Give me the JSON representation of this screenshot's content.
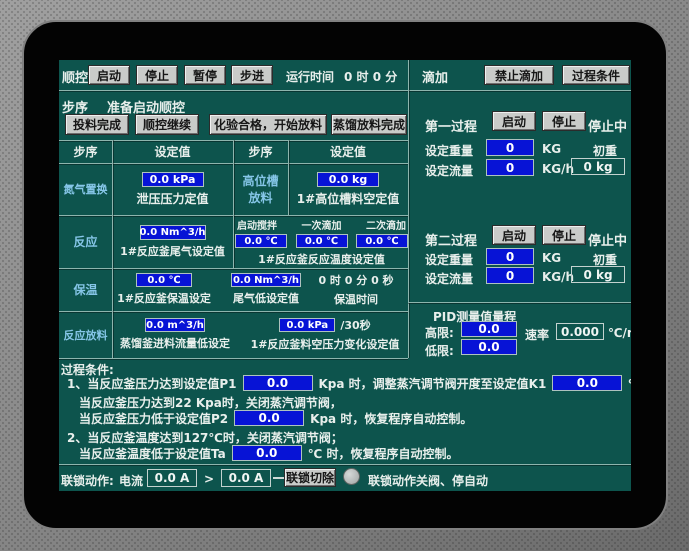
{
  "colors": {
    "screen_bg": "#0d544d",
    "input_blue": "#0713d6",
    "row_label_blue": "#86c6e8",
    "button_gray": "#c9cbc9",
    "divider": "#8db5ae"
  },
  "top_bar": {
    "seq_label": "顺控",
    "start": "启动",
    "stop": "停止",
    "pause": "暂停",
    "step": "步进",
    "runtime_label": "运行时间",
    "runtime_value": "0 时 0 分",
    "drip_label": "滴加",
    "forbid_drip": "禁止滴加",
    "process_cond": "过程条件"
  },
  "step_line": {
    "label": "步序",
    "value": "准备启动顺控"
  },
  "action_buttons": {
    "feed_done": "投料完成",
    "seq_continue": "顺控继续",
    "test_pass": "化验合格，开始放料",
    "distill_done": "蒸馏放料完成"
  },
  "table": {
    "header": [
      "步序",
      "设定值",
      "步序",
      "设定值"
    ],
    "row1": {
      "label": "氮气置换",
      "value1": "0.0 kPa",
      "caption1": "泄压压力定值",
      "label2": "高位槽放料",
      "value2": "0.0 kg",
      "caption2": "1#高位槽料空定值"
    },
    "row2": {
      "label": "反应",
      "value1": "0.0 Nm^3/h",
      "caption1": "1#反应釜尾气设定值",
      "sublabels": [
        "启动搅拌",
        "一次滴加",
        "二次滴加"
      ],
      "values": [
        "0.0 ℃",
        "0.0 ℃",
        "0.0 ℃"
      ],
      "caption2": "1#反应釜反应温度设定值"
    },
    "row3": {
      "label": "保温",
      "value1": "0.0 ℃",
      "caption1": "1#反应釜保温设定",
      "value2": "0.0 Nm^3/h",
      "caption2": "尾气低设定值",
      "time_value": "0 时 0 分 0 秒",
      "time_caption": "保温时间"
    },
    "row4": {
      "label": "反应放料",
      "value1": "0.0 m^3/h",
      "caption1": "蒸馏釜进料流量低设定",
      "value2": "0.0 kPa",
      "value2_suffix": "/30秒",
      "caption2": "1#反应釜料空压力变化设定值"
    }
  },
  "process1": {
    "title": "第一过程",
    "start": "启动",
    "stop": "停止",
    "status": "停止中",
    "weight_label": "设定重量",
    "weight_value": "0",
    "weight_unit": "KG",
    "init_label": "初重",
    "flow_label": "设定流量",
    "flow_value": "0",
    "flow_unit": "KG/h",
    "init_value": "0 kg"
  },
  "process2": {
    "title": "第二过程",
    "start": "启动",
    "stop": "停止",
    "status": "停止中",
    "weight_label": "设定重量",
    "weight_value": "0",
    "weight_unit": "KG",
    "init_label": "初重",
    "flow_label": "设定流量",
    "flow_value": "0",
    "flow_unit": "KG/h",
    "init_value": "0 kg"
  },
  "pid": {
    "title": "PID测量值量程",
    "high_label": "高限:",
    "high_value": "0.0",
    "low_label": "低限:",
    "low_value": "0.0",
    "rate_label": "速率",
    "rate_value": "0.000",
    "rate_unit": "℃/m"
  },
  "conditions": {
    "title": "过程条件:",
    "line1_pre": "1、当反应釜压力达到设定值P1",
    "line1_value": "0.0",
    "line1_mid": "Kpa 时，调整蒸汽调节阀开度至设定值K1",
    "line1_value2": "0.0",
    "line1_post": "%；",
    "line2": "当反应釜压力达到22 Kpa时，关闭蒸汽调节阀，",
    "line3_pre": "当反应釜压力低于设定值P2",
    "line3_value": "0.0",
    "line3_post": "Kpa 时，恢复程序自动控制。",
    "line4": "2、当反应釜温度达到127℃时，关闭蒸汽调节阀；",
    "line5_pre": "当反应釜温度低于设定值Ta",
    "line5_value": "0.0",
    "line5_post": "℃ 时，恢复程序自动控制。"
  },
  "interlock": {
    "label": "联锁动作:",
    "current_label": "电流",
    "value1": "0.0 A",
    "gt": ">",
    "value2": "0.0 A",
    "cut_button": "联锁切除",
    "caption": "联锁动作关阀、停自动"
  }
}
